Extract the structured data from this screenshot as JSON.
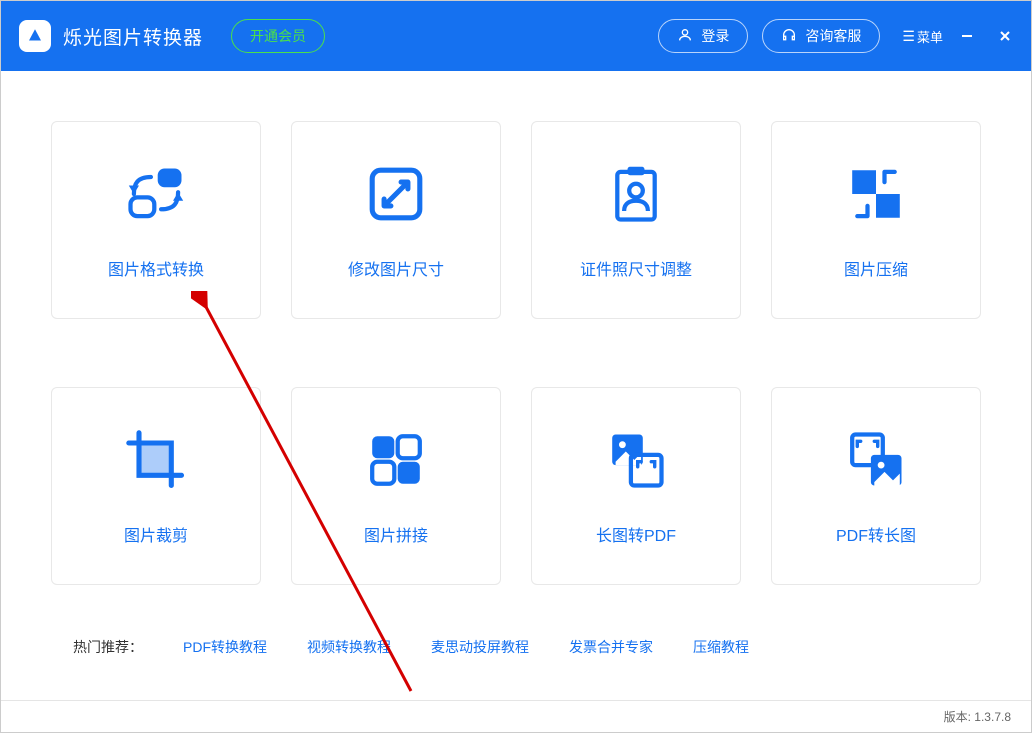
{
  "app_title": "烁光图片转换器",
  "vip": "开通会员",
  "login": "登录",
  "support": "咨询客服",
  "menu": "菜单",
  "cards": [
    {
      "label": "图片格式转换"
    },
    {
      "label": "修改图片尺寸"
    },
    {
      "label": "证件照尺寸调整"
    },
    {
      "label": "图片压缩"
    },
    {
      "label": "图片裁剪"
    },
    {
      "label": "图片拼接"
    },
    {
      "label": "长图转PDF"
    },
    {
      "label": "PDF转长图"
    }
  ],
  "hot_label": "热门推荐：",
  "hot_links": [
    "PDF转换教程",
    "视频转换教程",
    "麦思动投屏教程",
    "发票合并专家",
    "压缩教程"
  ],
  "version_label": "版本:",
  "version_value": "1.3.7.8"
}
